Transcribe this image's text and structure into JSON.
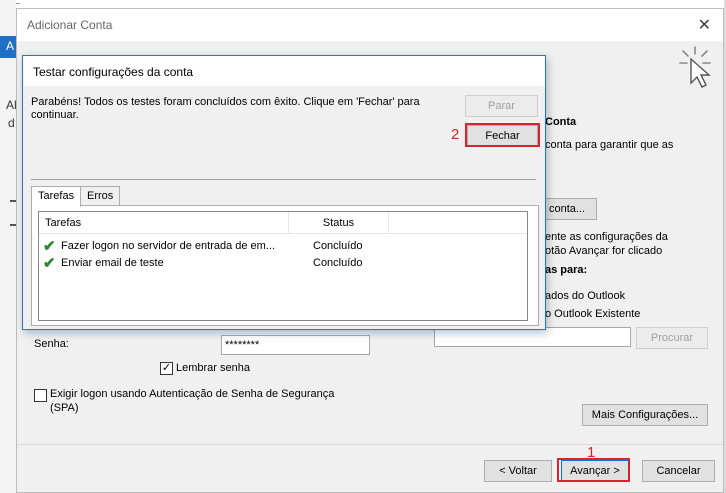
{
  "background": {
    "left_text_1": "A",
    "left_text_2": "Al",
    "left_text_3": "d"
  },
  "window": {
    "title": "Adicionar Conta",
    "close_glyph": "✕"
  },
  "right_panel": {
    "heading": "Conta",
    "line_1": "conta para garantir que as",
    "test_button": "conta...",
    "line_2": "ente as configurações da",
    "line_3": "otão Avançar for clicado",
    "line_4": "as para:",
    "option_1": "ados do Outlook",
    "option_2": "o Outlook Existente",
    "procurar_button": "Procurar"
  },
  "form": {
    "password_label": "Senha:",
    "password_value": "********",
    "remember_label": "Lembrar senha",
    "remember_checked": "✓",
    "spa_label": "Exigir logon usando Autenticação de Senha de Segurança",
    "spa_label_2": "(SPA)",
    "more_settings_button": "Mais Configurações..."
  },
  "nav": {
    "back_button": "< Voltar",
    "next_button": "Avançar >",
    "cancel_button": "Cancelar"
  },
  "annotations": {
    "num_1": "1",
    "num_2": "2",
    "color": "#d9232d"
  },
  "dialog": {
    "title": "Testar configurações da conta",
    "message": "Parabéns! Todos os testes foram concluídos com êxito. Clique em 'Fechar' para continuar.",
    "stop_button": "Parar",
    "close_button": "Fechar",
    "tabs": [
      "Tarefas",
      "Erros"
    ],
    "columns": {
      "task": "Tarefas",
      "status": "Status"
    },
    "rows": [
      {
        "task": "Fazer logon no servidor de entrada de em...",
        "status": "Concluído"
      },
      {
        "task": "Enviar email de teste",
        "status": "Concluído"
      }
    ],
    "check_glyph": "✔"
  }
}
